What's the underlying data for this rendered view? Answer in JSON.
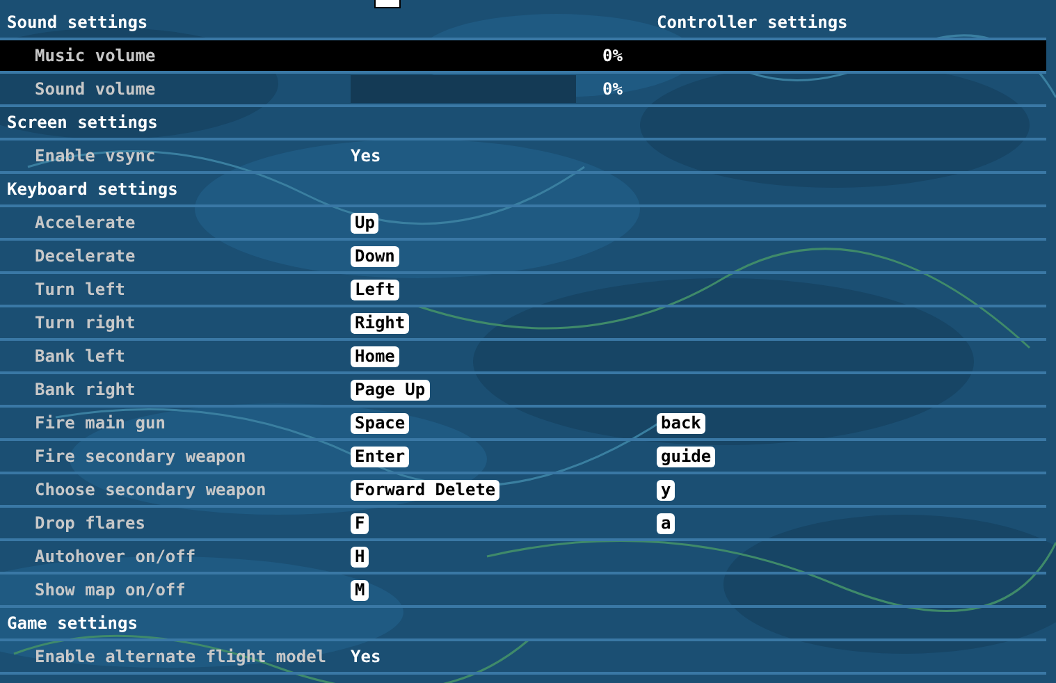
{
  "sections": [
    {
      "title": "Sound settings",
      "controller_title": "Controller settings",
      "items": [
        {
          "kind": "slider",
          "label": "Music volume",
          "reading": "0%",
          "selected": true
        },
        {
          "kind": "slider",
          "label": "Sound volume",
          "reading": "0%",
          "selected": false
        }
      ]
    },
    {
      "title": "Screen settings",
      "items": [
        {
          "kind": "toggle",
          "label": "Enable vsync",
          "value": "Yes",
          "selected": false
        }
      ]
    },
    {
      "title": "Keyboard settings",
      "items": [
        {
          "kind": "key",
          "label": "Accelerate",
          "key": "Up",
          "selected": false
        },
        {
          "kind": "key",
          "label": "Decelerate",
          "key": "Down",
          "selected": false
        },
        {
          "kind": "key",
          "label": "Turn left",
          "key": "Left",
          "selected": false
        },
        {
          "kind": "key",
          "label": "Turn right",
          "key": "Right",
          "selected": false
        },
        {
          "kind": "key",
          "label": "Bank left",
          "key": "Home",
          "selected": false
        },
        {
          "kind": "key",
          "label": "Bank right",
          "key": "Page Up",
          "selected": false
        },
        {
          "kind": "key",
          "label": "Fire main gun",
          "key": "Space",
          "button": "back",
          "selected": false
        },
        {
          "kind": "key",
          "label": "Fire secondary weapon",
          "key": "Enter",
          "button": "guide",
          "selected": false
        },
        {
          "kind": "key",
          "label": "Choose secondary weapon",
          "key": "Forward Delete",
          "button": "y",
          "selected": false
        },
        {
          "kind": "key",
          "label": "Drop flares",
          "key": "F",
          "button": "a",
          "selected": false
        },
        {
          "kind": "key",
          "label": "Autohover on/off",
          "key": "H",
          "selected": false
        },
        {
          "kind": "key",
          "label": "Show map on/off",
          "key": "M",
          "selected": false
        }
      ]
    },
    {
      "title": "Game settings",
      "items": [
        {
          "kind": "toggle",
          "label": "Enable alternate flight model",
          "value": "Yes",
          "selected": false
        }
      ]
    }
  ]
}
